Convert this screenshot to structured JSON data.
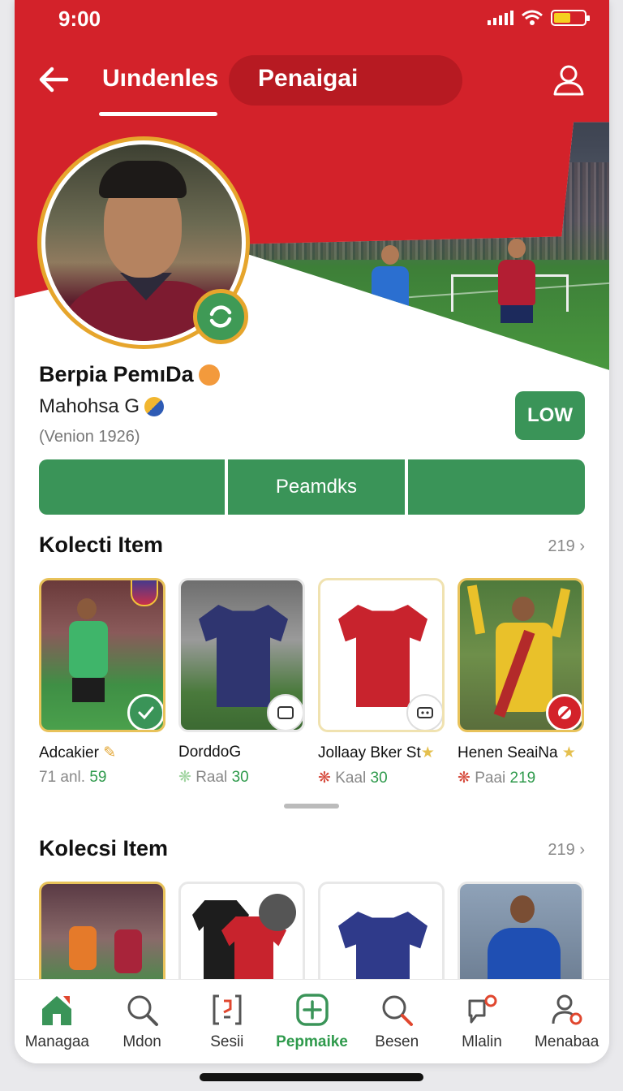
{
  "status_bar": {
    "time": "9:00"
  },
  "header": {
    "tabs": [
      {
        "label": "Uındenles"
      },
      {
        "label": "Penaigai"
      }
    ]
  },
  "profile": {
    "name": "Berpia PemıDa",
    "subname": "Mahohsa G",
    "meta": "(Venion 1926)",
    "follow_label": "LOW",
    "actions": [
      {
        "label": ""
      },
      {
        "label": "Peamdks"
      },
      {
        "label": ""
      }
    ]
  },
  "sections": [
    {
      "title": "Kolecti  Item",
      "count": "219",
      "items": [
        {
          "title": "Adcakier",
          "meta_prefix": "71 anl.",
          "price": "59"
        },
        {
          "title": "DorddoG",
          "meta_prefix": "Raal",
          "price": "30"
        },
        {
          "title": "Jollaay Bker St",
          "meta_prefix": "Kaal",
          "price": "30"
        },
        {
          "title": "Henen SeaiNa",
          "meta_prefix": "Paai",
          "price": "219"
        }
      ]
    },
    {
      "title": "Kolecsi Item",
      "count": "219"
    }
  ],
  "bottom_nav": [
    {
      "label": "Managaa",
      "icon": "home-icon"
    },
    {
      "label": "Mdon",
      "icon": "search-icon"
    },
    {
      "label": "Sesii",
      "icon": "collection-icon"
    },
    {
      "label": "Pepmaike",
      "icon": "add-icon"
    },
    {
      "label": "Besen",
      "icon": "search-icon"
    },
    {
      "label": "Mlalin",
      "icon": "notification-icon"
    },
    {
      "label": "Menabaa",
      "icon": "profile-icon"
    }
  ],
  "colors": {
    "brand_red": "#d3222a",
    "brand_green": "#3a9458",
    "gold": "#e6a52c"
  }
}
